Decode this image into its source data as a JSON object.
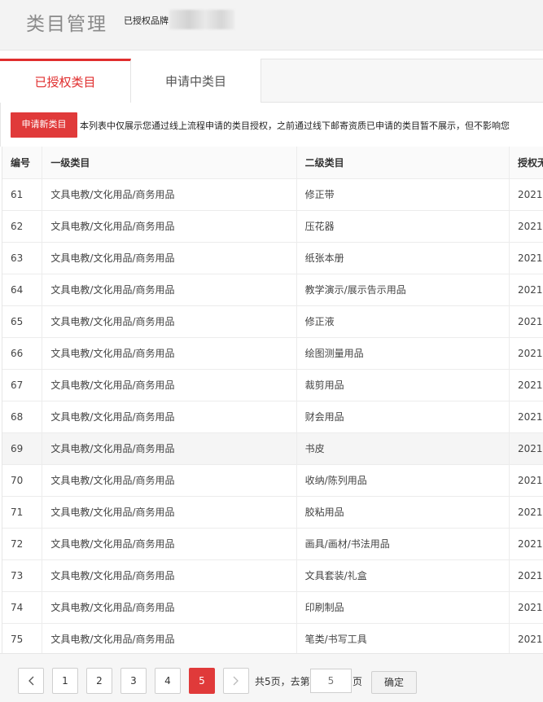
{
  "header": {
    "title": "类目管理",
    "brand_label": "已授权品牌"
  },
  "tabs": [
    {
      "label": "已授权类目",
      "active": true
    },
    {
      "label": "申请中类目",
      "active": false
    }
  ],
  "notice": {
    "apply_button": "申请新类目",
    "text": "本列表中仅展示您通过线上流程申请的类目授权，之前通过线下邮寄资质已申请的类目暂不展示，但不影响您"
  },
  "table": {
    "headers": [
      "编号",
      "一级类目",
      "二级类目",
      "授权无"
    ],
    "rows": [
      {
        "id": "61",
        "level1": "文具电教/文化用品/商务用品",
        "level2": "修正带",
        "date": "2021-"
      },
      {
        "id": "62",
        "level1": "文具电教/文化用品/商务用品",
        "level2": "压花器",
        "date": "2021-"
      },
      {
        "id": "63",
        "level1": "文具电教/文化用品/商务用品",
        "level2": "纸张本册",
        "date": "2021-"
      },
      {
        "id": "64",
        "level1": "文具电教/文化用品/商务用品",
        "level2": "教学演示/展示告示用品",
        "date": "2021-"
      },
      {
        "id": "65",
        "level1": "文具电教/文化用品/商务用品",
        "level2": "修正液",
        "date": "2021-"
      },
      {
        "id": "66",
        "level1": "文具电教/文化用品/商务用品",
        "level2": "绘图测量用品",
        "date": "2021-"
      },
      {
        "id": "67",
        "level1": "文具电教/文化用品/商务用品",
        "level2": "裁剪用品",
        "date": "2021-"
      },
      {
        "id": "68",
        "level1": "文具电教/文化用品/商务用品",
        "level2": "财会用品",
        "date": "2021-"
      },
      {
        "id": "69",
        "level1": "文具电教/文化用品/商务用品",
        "level2": "书皮",
        "date": "2021-"
      },
      {
        "id": "70",
        "level1": "文具电教/文化用品/商务用品",
        "level2": "收纳/陈列用品",
        "date": "2021-"
      },
      {
        "id": "71",
        "level1": "文具电教/文化用品/商务用品",
        "level2": "胶粘用品",
        "date": "2021-"
      },
      {
        "id": "72",
        "level1": "文具电教/文化用品/商务用品",
        "level2": "画具/画材/书法用品",
        "date": "2021-"
      },
      {
        "id": "73",
        "level1": "文具电教/文化用品/商务用品",
        "level2": "文具套装/礼盒",
        "date": "2021-"
      },
      {
        "id": "74",
        "level1": "文具电教/文化用品/商务用品",
        "level2": "印刷制品",
        "date": "2021-"
      },
      {
        "id": "75",
        "level1": "文具电教/文化用品/商务用品",
        "level2": "笔类/书写工具",
        "date": "2021-"
      }
    ]
  },
  "pagination": {
    "pages": [
      "1",
      "2",
      "3",
      "4",
      "5"
    ],
    "current": "5",
    "total_text": "共5页，去第",
    "input_value": "5",
    "page_suffix": "页",
    "confirm_label": "确定"
  },
  "colors": {
    "accent": "#e03a3a"
  }
}
